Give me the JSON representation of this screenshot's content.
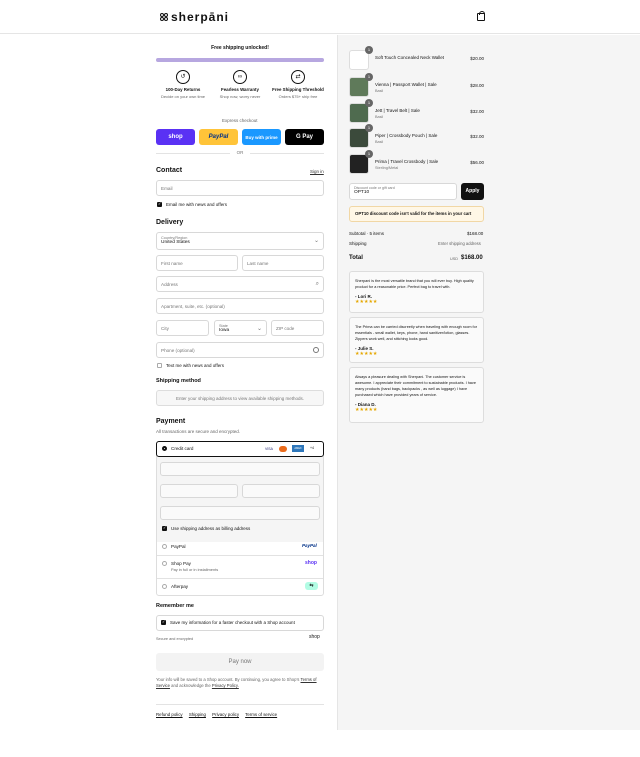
{
  "brand": {
    "name": "sherpāni"
  },
  "banner": {
    "text": "Free shipping unlocked!"
  },
  "features": [
    {
      "title": "100-Day Returns",
      "subtitle": "Decide on your own time",
      "icon": "return-icon"
    },
    {
      "title": "Fearless Warranty",
      "subtitle": "Shop now, worry never",
      "icon": "warranty-icon"
    },
    {
      "title": "Free Shipping Threshold",
      "subtitle": "Orders $75+ ship free",
      "icon": "shipping-icon"
    }
  ],
  "express": {
    "label": "Express checkout",
    "or": "OR",
    "buttons": [
      "shop",
      "PayPal",
      "Buy with prime",
      "G Pay"
    ]
  },
  "contact": {
    "heading": "Contact",
    "sign_in": "Sign in",
    "email_placeholder": "Email",
    "newsletter": "Email me with news and offers"
  },
  "delivery": {
    "heading": "Delivery",
    "country_label": "Country/Region",
    "country": "United States",
    "first_name": "First name",
    "last_name": "Last name",
    "address": "Address",
    "apartment": "Apartment, suite, etc. (optional)",
    "city": "City",
    "state_label": "State",
    "state": "Iowa",
    "zip": "ZIP code",
    "phone": "Phone (optional)",
    "text_offer": "Text me with news and offers"
  },
  "shipping": {
    "heading": "Shipping method",
    "note": "Enter your shipping address to view available shipping methods."
  },
  "payment": {
    "heading": "Payment",
    "subheading": "All transactions are secure and encrypted.",
    "credit_card": "Credit card",
    "billing": "Use shipping address as billing address",
    "paypal": "PayPal",
    "shop_pay": "Shop Pay",
    "shop_pay_sub": "Pay in full or in installments",
    "afterpay": "Afterpay",
    "card_badges": [
      "VISA",
      "MC",
      "AMEX",
      "+4"
    ]
  },
  "remember": {
    "heading": "Remember me",
    "save_info": "Save my information for a faster checkout with a Shop account",
    "secure": "Secure and encrypted",
    "shop_logo": "shop"
  },
  "pay_now": "Pay now",
  "legal": {
    "text1": "Your info will be saved to a Shop account. By continuing, you agree to Shop’s",
    "terms": "Terms of Service",
    "text2": "and acknowledge the",
    "privacy": "Privacy Policy."
  },
  "footer_links": [
    "Refund policy",
    "Shipping",
    "Privacy policy",
    "Terms of service"
  ],
  "cart": {
    "items": [
      {
        "qty": "1",
        "name": "Soft Touch Concealed Neck Wallet",
        "sub": "",
        "price": "$20.00"
      },
      {
        "qty": "1",
        "name": "Vienna | Passport Wallet | Sale",
        "sub": "Basil",
        "price": "$28.00"
      },
      {
        "qty": "1",
        "name": "Jett | Travel Belt | Sale",
        "sub": "Basil",
        "price": "$32.00"
      },
      {
        "qty": "1",
        "name": "Piper | Crossbody Pouch | Sale",
        "sub": "Basil",
        "price": "$32.00"
      },
      {
        "qty": "1",
        "name": "Prima | Travel Crossbody | Sale",
        "sub": "Sterling/Metal",
        "price": "$56.00"
      }
    ],
    "discount_label": "Discount code or gift card",
    "discount_value": "OPT10",
    "apply": "Apply",
    "warning": "OPT10 discount code isn't valid for the items in your cart",
    "subtotal_label": "Subtotal · 5 items",
    "subtotal": "$168.00",
    "shipping_label": "Shipping",
    "shipping_value": "Enter shipping address",
    "total_label": "Total",
    "currency": "USD",
    "total": "$168.00"
  },
  "reviews": [
    {
      "text": "Sherpani is the most versatile brand that you will ever buy. High quality product for a reasonable price. Perfect bag to travel with.",
      "name": "- Lori R.",
      "stars": "★★★★★"
    },
    {
      "text": "The Prima can be carried discreetly when traveling with enough room for essentials - small wallet, keys, phone, hand sanitizer/lotion, glasses. Zippers work well, and stitching looks good.",
      "name": "- Julie S.",
      "stars": "★★★★★"
    },
    {
      "text": "Always a pleasure dealing with Sherpani. The customer service is awesome. I appreciate their commitment to sustainable products. I have many products (hand bags, backpacks , as well as luggage) I have purchased which have provided years of service.",
      "name": "- Diana D.",
      "stars": "★★★★★"
    }
  ]
}
